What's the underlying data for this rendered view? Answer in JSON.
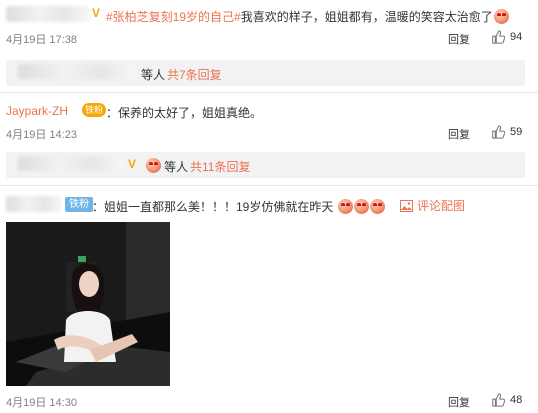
{
  "comments": [
    {
      "topic": "#张柏芝复刻19岁的自己#",
      "text": "我喜欢的样子，姐姐都有，温暖的笑容太治愈了",
      "time": "4月19日 17:38",
      "reply": "回复",
      "likes": "94",
      "sub_wait": "等人",
      "sub_more": "共7条回复"
    },
    {
      "user": "Jaypark-ZH",
      "badge": "铁粉",
      "text": "：保养的太好了，姐姐真绝。",
      "time": "4月19日 14:23",
      "reply": "回复",
      "likes": "59",
      "sub_wait": "等人",
      "sub_more": "共11条回复"
    },
    {
      "badge": "铁粉",
      "text": "：姐姐一直都那么美！！！19岁仿佛就在昨天",
      "pic_link": "评论配图",
      "time": "4月19日 14:30",
      "reply": "回复",
      "likes": "48"
    }
  ],
  "icons": {
    "like": "thumbs-up-icon",
    "pic": "picture-icon",
    "vip": "verified-v-icon"
  },
  "colors": {
    "link": "#eb7350",
    "fan_badge": "#f6a70a",
    "iron_badge": "#6fb4e8",
    "subbox": "#f2f2f5"
  }
}
